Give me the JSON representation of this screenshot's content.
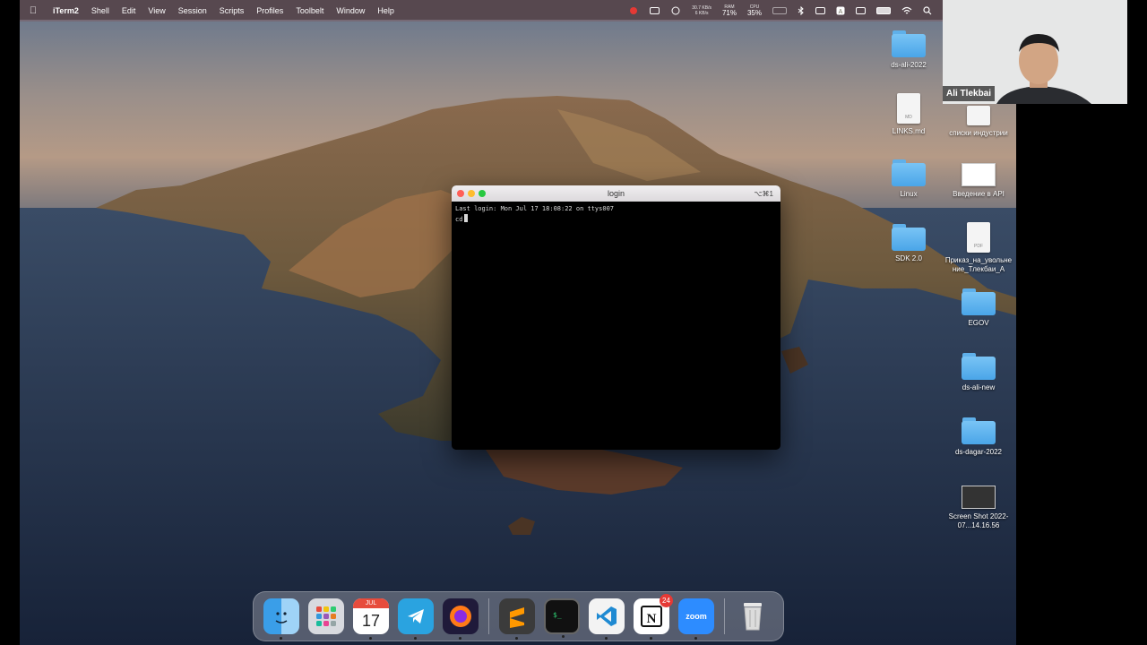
{
  "menubar": {
    "app_name": "iTerm2",
    "menus": [
      "Shell",
      "Edit",
      "View",
      "Session",
      "Scripts",
      "Profiles",
      "Toolbelt",
      "Window",
      "Help"
    ],
    "network_up": "30.7 KB/s",
    "network_down": "6 KB/s",
    "ram_label": "RAM",
    "ram_value": "71%",
    "cpu_label": "CPU",
    "cpu_value": "35%"
  },
  "video": {
    "participant_name": "Ali Tlekbai"
  },
  "desktop_icons": {
    "ds_ali_2022": "ds-ali-2022",
    "links_md": "LINKS.md",
    "links_ext": "MD",
    "spiski": "списки индустрии",
    "linux": "Linux",
    "vvedenie": "Введение в API",
    "sdk": "SDK 2.0",
    "prikaz": "Приказ_на_увольнение_Тлекбаи_А",
    "prikaz_ext": "PDF",
    "egov": "EGOV",
    "ds_ali_new": "ds-ali-new",
    "ds_dagar": "ds-dagar-2022",
    "screenshot": "Screen Shot 2022-07...14.16.56"
  },
  "terminal": {
    "title": "login",
    "shortcut": "⌥⌘1",
    "line1": "Last login: Mon Jul 17 18:08:22 on ttys007",
    "line2": "cd"
  },
  "dock": {
    "calendar_month": "JUL",
    "calendar_day": "17",
    "notion_badge": "24",
    "zoom_label": "zoom"
  },
  "colors": {
    "folder_blue": "#4aa5e8",
    "close_red": "#ff5f57",
    "minimize_yellow": "#febc2e",
    "zoom_green": "#28c840"
  }
}
